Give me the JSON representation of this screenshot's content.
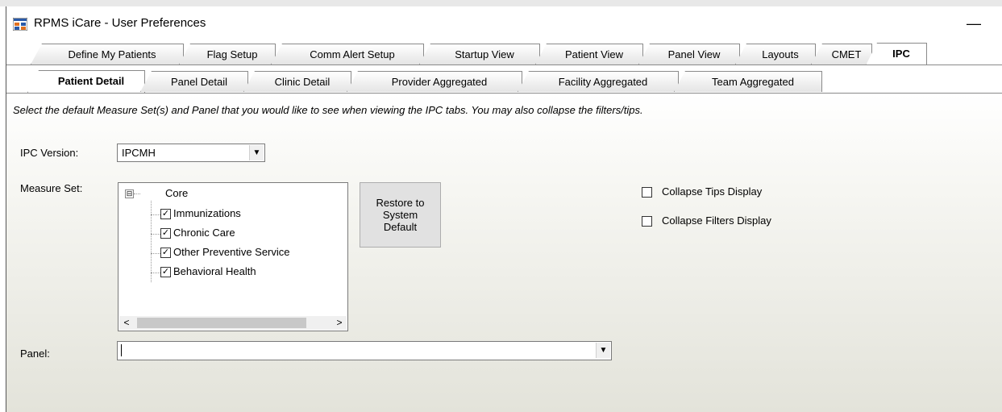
{
  "window": {
    "title": "RPMS iCare - User Preferences",
    "minimize_glyph": "—"
  },
  "tabs_top": [
    {
      "label": "Define My Patients"
    },
    {
      "label": "Flag Setup"
    },
    {
      "label": "Comm Alert Setup"
    },
    {
      "label": "Startup View"
    },
    {
      "label": "Patient View"
    },
    {
      "label": "Panel View"
    },
    {
      "label": "Layouts"
    },
    {
      "label": "CMET"
    },
    {
      "label": "IPC",
      "selected": true
    }
  ],
  "tabs_sub": [
    {
      "label": "Patient Detail",
      "selected": true
    },
    {
      "label": "Panel Detail"
    },
    {
      "label": "Clinic Detail"
    },
    {
      "label": "Provider Aggregated"
    },
    {
      "label": "Facility Aggregated"
    },
    {
      "label": "Team Aggregated"
    }
  ],
  "main": {
    "instruction": "Select the default Measure Set(s) and Panel that you would like to see when viewing the IPC tabs. You may also collapse the filters/tips.",
    "ipc_version": {
      "label": "IPC Version:",
      "value": "IPCMH"
    },
    "measure_set": {
      "label": "Measure Set:",
      "root": {
        "label": "Core",
        "expander": "⊟"
      },
      "items": [
        {
          "label": "Immunizations",
          "checked": true
        },
        {
          "label": "Chronic Care",
          "checked": true
        },
        {
          "label": "Other Preventive Service",
          "checked": true
        },
        {
          "label": "Behavioral Health",
          "checked": true
        }
      ],
      "scroll_left": "<",
      "scroll_right": ">"
    },
    "restore_button": "Restore to System Default",
    "collapse_tips": {
      "label": "Collapse Tips Display",
      "checked": false
    },
    "collapse_filters": {
      "label": "Collapse Filters Display",
      "checked": false
    },
    "panel": {
      "label": "Panel:",
      "value": ""
    }
  },
  "colors": {
    "tab_border": "#8a8a8a",
    "button_bg": "#e1e1e1"
  },
  "icons": {
    "app": "app-window-icon",
    "dropdown": "chevron-down-icon",
    "check": "checkmark-icon"
  }
}
